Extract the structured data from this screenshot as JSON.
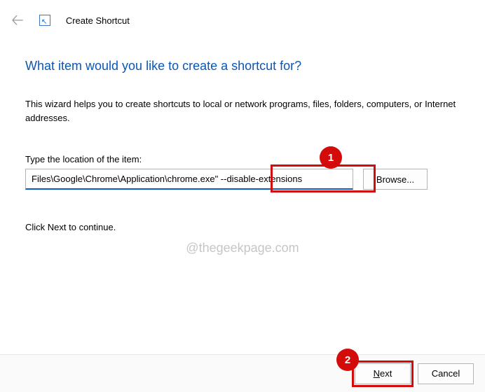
{
  "header": {
    "title": "Create Shortcut"
  },
  "content": {
    "question": "What item would you like to create a shortcut for?",
    "description": "This wizard helps you to create shortcuts to local or network programs, files, folders, computers, or Internet addresses.",
    "location_label": "Type the location of the item:",
    "location_value": "Files\\Google\\Chrome\\Application\\chrome.exe\" --disable-extensions",
    "browse_label": "Browse...",
    "continue_text": "Click Next to continue."
  },
  "footer": {
    "next_accel": "N",
    "next_rest": "ext",
    "cancel_label": "Cancel"
  },
  "annotations": {
    "callout1": "1",
    "callout2": "2",
    "watermark": "@thegeekpage.com"
  }
}
